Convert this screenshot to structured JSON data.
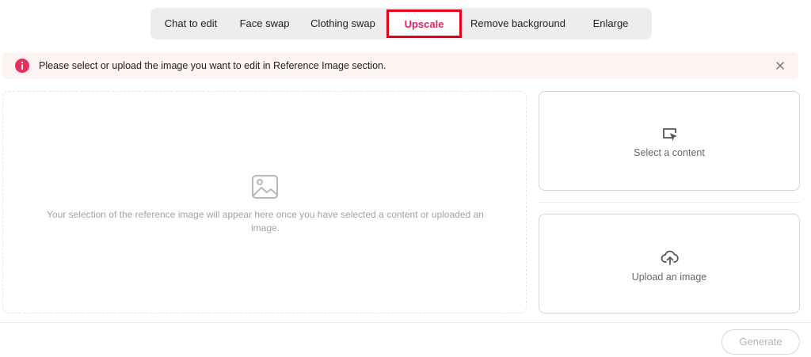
{
  "tabs": [
    {
      "label": "Chat to edit",
      "active": false
    },
    {
      "label": "Face swap",
      "active": false
    },
    {
      "label": "Clothing swap",
      "active": false
    },
    {
      "label": "Upscale",
      "active": true
    },
    {
      "label": "Remove background",
      "active": false
    },
    {
      "label": "Enlarge",
      "active": false
    }
  ],
  "alert": {
    "message": "Please select or upload the image you want to edit in Reference Image section.",
    "icon": "info-icon",
    "color": "#e8315a"
  },
  "preview": {
    "icon": "image-icon",
    "placeholder": "Your selection of the reference image will appear here once you have selected a content or uploaded an image."
  },
  "sources": {
    "select": {
      "label": "Select a content",
      "icon": "cursor-select-icon"
    },
    "upload": {
      "label": "Upload an image",
      "icon": "cloud-upload-icon"
    }
  },
  "actions": {
    "generate_label": "Generate"
  },
  "colors": {
    "accent": "#e0245e",
    "highlight_border": "#e3001b",
    "tabbar_bg": "#ededed"
  }
}
